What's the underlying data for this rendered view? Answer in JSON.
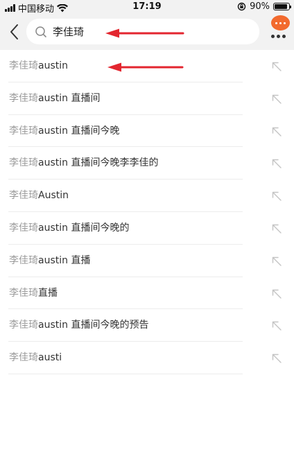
{
  "status_bar": {
    "carrier": "中国移动",
    "time": "17:19",
    "battery": "90%",
    "battery_level": 0.9
  },
  "search": {
    "query": "李佳琦",
    "placeholder": ""
  },
  "icons": {
    "back": "chevron-left-icon",
    "search": "magnifier-icon",
    "message": "chat-bubble-icon",
    "more": "more-dots-icon",
    "fill": "arrow-up-left-icon",
    "annotation": "red-arrow-icon"
  },
  "colors": {
    "header_bg": "#f2f2f2",
    "bubble": "#f26a2e",
    "annotation_arrow": "#e3262f",
    "prefix_text": "#9a9a9a",
    "rest_text": "#333333"
  },
  "suggestions": [
    {
      "prefix": "李佳琦",
      "rest": "austin"
    },
    {
      "prefix": "李佳琦",
      "rest": "austin 直播间"
    },
    {
      "prefix": "李佳琦",
      "rest": "austin 直播间今晚"
    },
    {
      "prefix": "李佳琦",
      "rest": "austin 直播间今晚李李佳的"
    },
    {
      "prefix": "李佳琦",
      "rest": "Austin"
    },
    {
      "prefix": "李佳琦",
      "rest": "austin 直播间今晚的"
    },
    {
      "prefix": "李佳琦",
      "rest": "austin 直播"
    },
    {
      "prefix": "李佳琦",
      "rest": "直播"
    },
    {
      "prefix": "李佳琦",
      "rest": "austin 直播间今晚的预告"
    },
    {
      "prefix": "李佳琦",
      "rest": "austi"
    }
  ]
}
